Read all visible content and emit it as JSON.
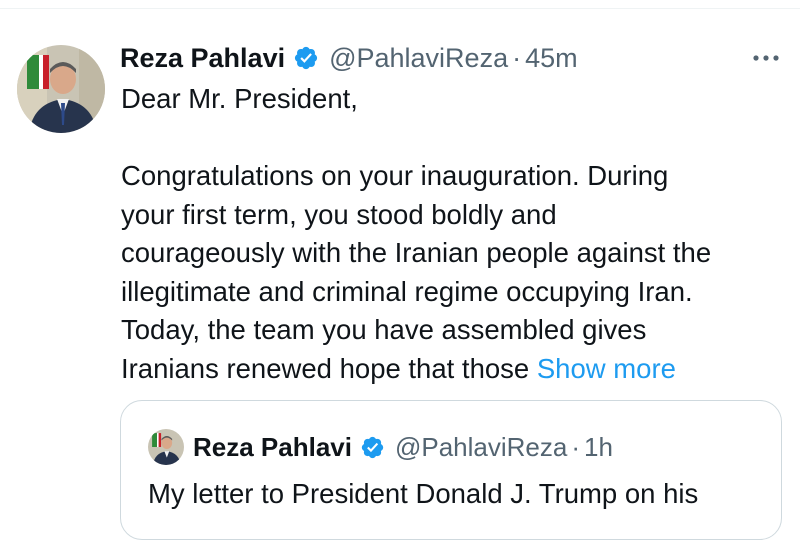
{
  "tweet": {
    "author_name": "Reza Pahlavi",
    "handle": "@PahlaviReza",
    "separator": "·",
    "time": "45m",
    "more_icon": "more-horizontal-icon",
    "body_lines": [
      "Dear Mr. President,",
      "Congratulations on your inauguration. During",
      "your first term, you stood boldly and",
      "courageously with the Iranian people against the",
      "illegitimate and criminal regime occupying Iran.",
      "Today, the team you have assembled gives",
      "Iranians renewed hope that those "
    ],
    "show_more": "Show more"
  },
  "quote": {
    "author_name": "Reza Pahlavi",
    "handle": "@PahlaviReza",
    "separator": "·",
    "time": "1h",
    "text": "My letter to President Donald J. Trump on his"
  },
  "colors": {
    "link": "#1d9bf0",
    "secondary_text": "#536471",
    "verified": "#1d9bf0",
    "border": "#cfd9de"
  }
}
